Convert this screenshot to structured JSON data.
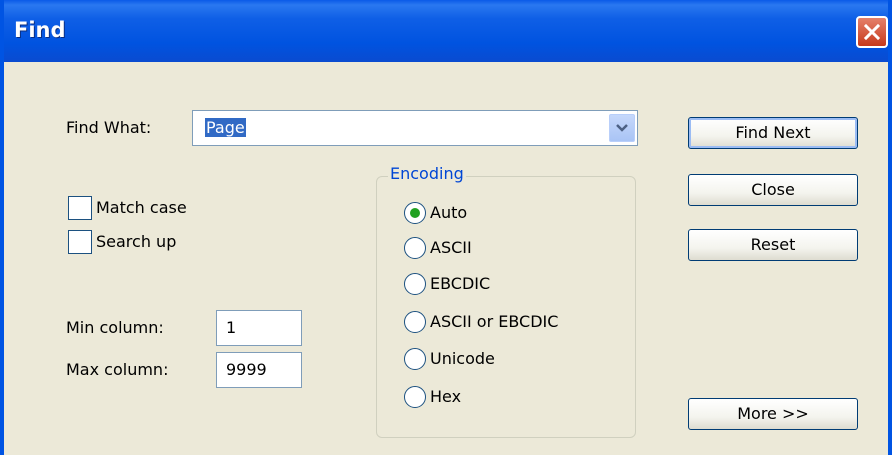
{
  "window": {
    "title": "Find"
  },
  "find_what": {
    "label": "Find What:",
    "value": "Page"
  },
  "options": {
    "match_case": {
      "label": "Match case",
      "checked": false
    },
    "search_up": {
      "label": "Search up",
      "checked": false
    }
  },
  "columns": {
    "min": {
      "label": "Min column:",
      "value": "1"
    },
    "max": {
      "label": "Max column:",
      "value": "9999"
    }
  },
  "encoding": {
    "legend": "Encoding",
    "selected": "Auto",
    "options": [
      "Auto",
      "ASCII",
      "EBCDIC",
      "ASCII or EBCDIC",
      "Unicode",
      "Hex"
    ]
  },
  "buttons": {
    "find_next": "Find Next",
    "close": "Close",
    "reset": "Reset",
    "more": "More >>"
  },
  "colors": {
    "title_bar": "#0054e3",
    "dialog_bg": "#ece9d8",
    "selection": "#316ac5",
    "radio_dot": "#21a121"
  }
}
